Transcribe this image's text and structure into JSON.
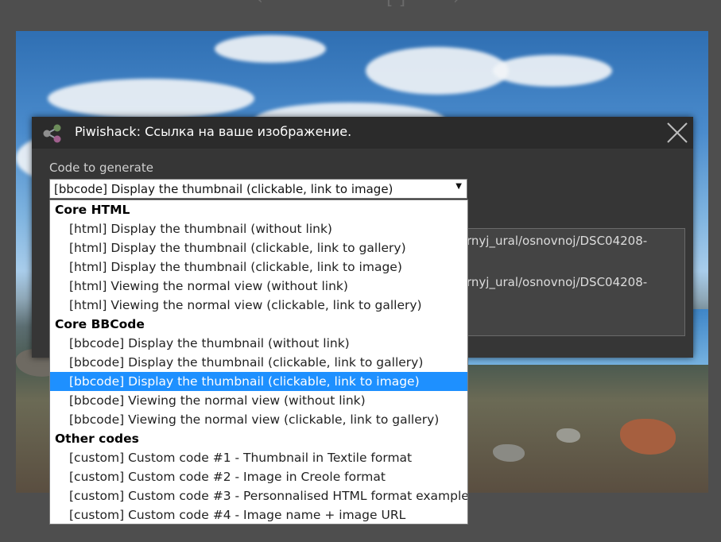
{
  "dialog": {
    "title": "Piwishack:  Ссылка на ваше изображение.",
    "code_label": "Code to generate",
    "link_lines": [
      "rnyj_ural/osnovnoj/DSC04208-",
      "rnyj_ural/osnovnoj/DSC04208-"
    ]
  },
  "select": {
    "value": "[bbcode] Display the thumbnail (clickable, link to image)",
    "arrow": "▼"
  },
  "dropdown": {
    "groups": [
      {
        "label": "Core HTML",
        "options": [
          "[html] Display the thumbnail (without link)",
          "[html] Display the thumbnail (clickable, link to gallery)",
          "[html] Display the thumbnail (clickable, link to image)",
          "[html] Viewing the normal view (without link)",
          "[html] Viewing the normal view (clickable, link to gallery)"
        ]
      },
      {
        "label": "Core BBCode",
        "options": [
          "[bbcode] Display the thumbnail (without link)",
          "[bbcode] Display the thumbnail (clickable, link to gallery)",
          "[bbcode] Display the thumbnail (clickable, link to image)",
          "[bbcode] Viewing the normal view (without link)",
          "[bbcode] Viewing the normal view (clickable, link to gallery)"
        ]
      },
      {
        "label": "Other codes",
        "options": [
          "[custom] Custom code #1 - Thumbnail in Textile format",
          "[custom] Custom code #2 - Image in Creole format",
          "[custom] Custom code #3 - Personnalised HTML format example",
          "[custom] Custom code #4 - Image name + image URL"
        ]
      }
    ],
    "selected_group": 1,
    "selected_option": 2
  },
  "icons": {
    "share": "share-icon",
    "close": "close-icon"
  },
  "colors": {
    "highlight": "#1e90ff",
    "dialog_bg": "#363636",
    "header_bg": "#2b2b2b"
  }
}
